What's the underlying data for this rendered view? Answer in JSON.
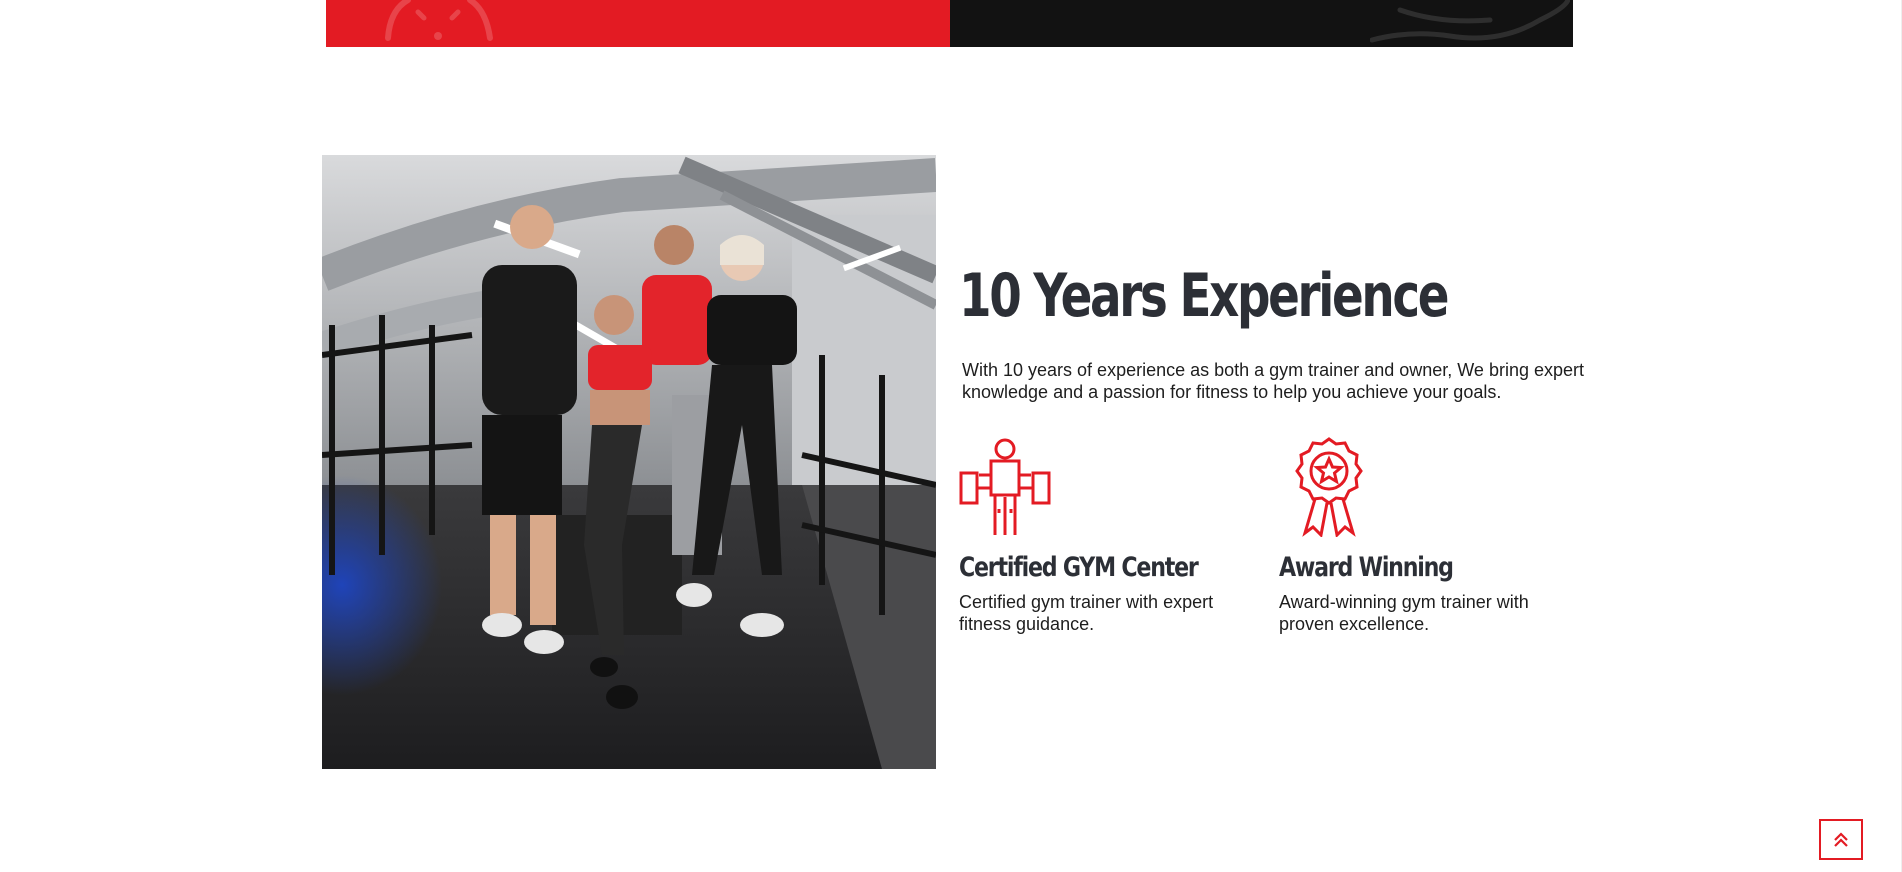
{
  "about": {
    "heading": "10 Years Experience",
    "intro": "With 10 years of experience as both a gym trainer and owner, We bring expert knowledge and a passion for fitness to help you achieve your goals.",
    "photo_alt": "Gym team photo",
    "features": [
      {
        "icon": "weightlifter-icon",
        "title": "Certified GYM Center",
        "description": "Certified gym trainer with expert fitness guidance."
      },
      {
        "icon": "award-ribbon-icon",
        "title": "Award Winning",
        "description": "Award-winning gym trainer with proven excellence."
      }
    ]
  },
  "colors": {
    "accent": "#e31b23",
    "dark": "#121212",
    "heading": "#2c2f36",
    "text": "#1e1e1e"
  }
}
